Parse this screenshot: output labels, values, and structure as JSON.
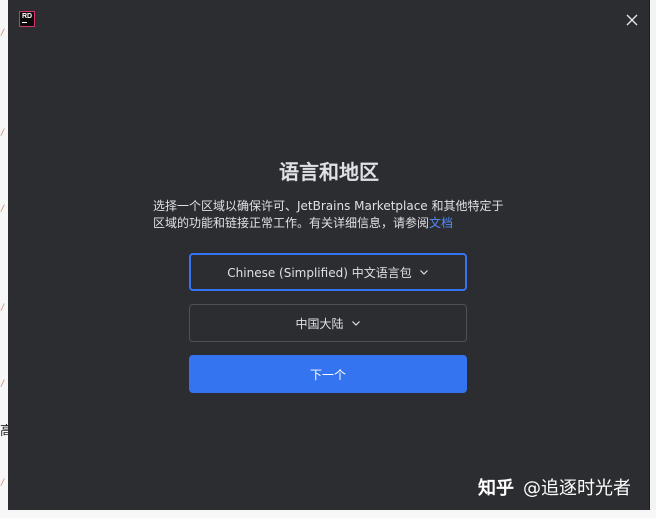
{
  "background": {
    "marks": [
      "/",
      "/",
      "/",
      "/",
      "/",
      "/"
    ],
    "char": "高"
  },
  "app": {
    "logo_text": "RD",
    "icons": {
      "logo": "rider-logo-icon",
      "close": "close-icon",
      "chevron": "chevron-down-icon"
    }
  },
  "dialog": {
    "title": "语言和地区",
    "description": "选择一个区域以确保许可、JetBrains Marketplace 和其他特定于区域的功能和链接正常工作。有关详细信息，请参阅",
    "doc_link": "文档",
    "language_select": {
      "value": "Chinese (Simplified) 中文语言包"
    },
    "region_select": {
      "value": "中国大陆"
    },
    "next_button": "下一个"
  },
  "watermark": {
    "brand": "知乎",
    "author": "@追逐时光者"
  },
  "colors": {
    "dialog_bg": "#2b2d30",
    "accent": "#3574f0",
    "link": "#548af7",
    "text": "#dfe1e5"
  }
}
